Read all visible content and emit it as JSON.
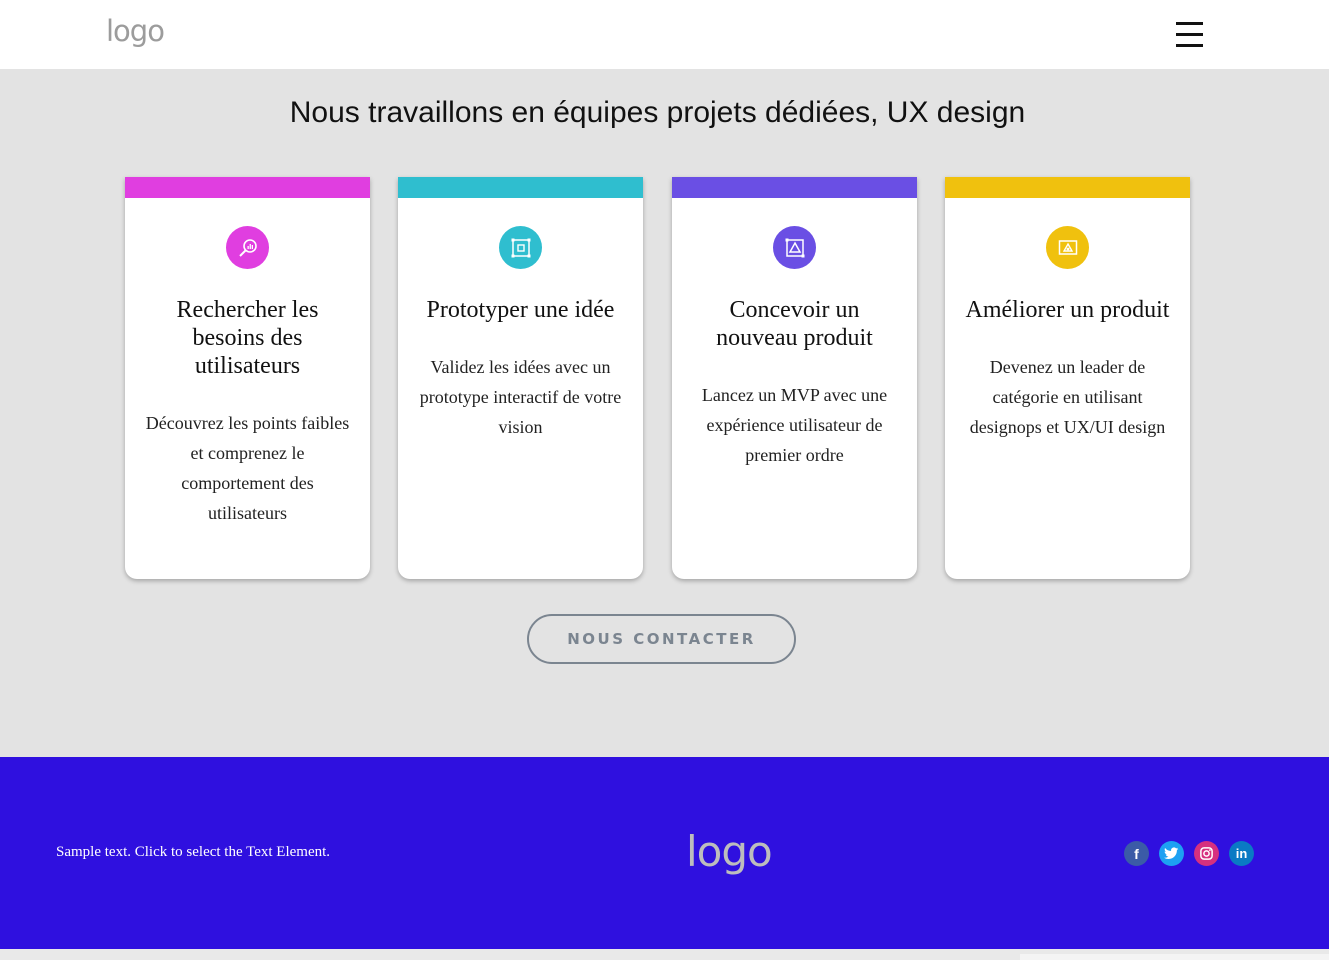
{
  "header": {
    "logo": "logo",
    "menu_icon": "hamburger-menu-icon"
  },
  "section": {
    "heading": "Nous travaillons en équipes projets dédiées, UX design"
  },
  "cards": [
    {
      "title": "Rechercher les besoins des utilisateurs",
      "text": "Découvrez les points faibles et comprenez le comportement des utilisateurs",
      "color": "#e03ee0",
      "icon": "search-analytics-icon"
    },
    {
      "title": "Prototyper une idée",
      "text": "Validez les idées avec un prototype interactif de votre vision",
      "color": "#2fbecf",
      "icon": "prototype-icon"
    },
    {
      "title": "Concevoir un nouveau produit",
      "text": "Lancez un MVP avec une expérience utilisateur de premier ordre",
      "color": "#6a4fe4",
      "icon": "design-triangle-icon"
    },
    {
      "title": "Améliorer un produit",
      "text": "Devenez un leader de catégorie en utilisant designops et UX/UI design",
      "color": "#f0c10e",
      "icon": "improve-product-icon"
    }
  ],
  "contact_button": "NOUS CONTACTER",
  "footer": {
    "text": "Sample text. Click to select the Text Element.",
    "logo": "logo",
    "background": "#2f10df",
    "social": [
      {
        "name": "facebook",
        "glyph": "f",
        "color": "#3b5ba7"
      },
      {
        "name": "twitter",
        "glyph": "t",
        "color": "#1da1f2"
      },
      {
        "name": "instagram",
        "glyph": "◎",
        "color": "#d6307f"
      },
      {
        "name": "linkedin",
        "glyph": "in",
        "color": "#0a7ac4"
      }
    ]
  }
}
